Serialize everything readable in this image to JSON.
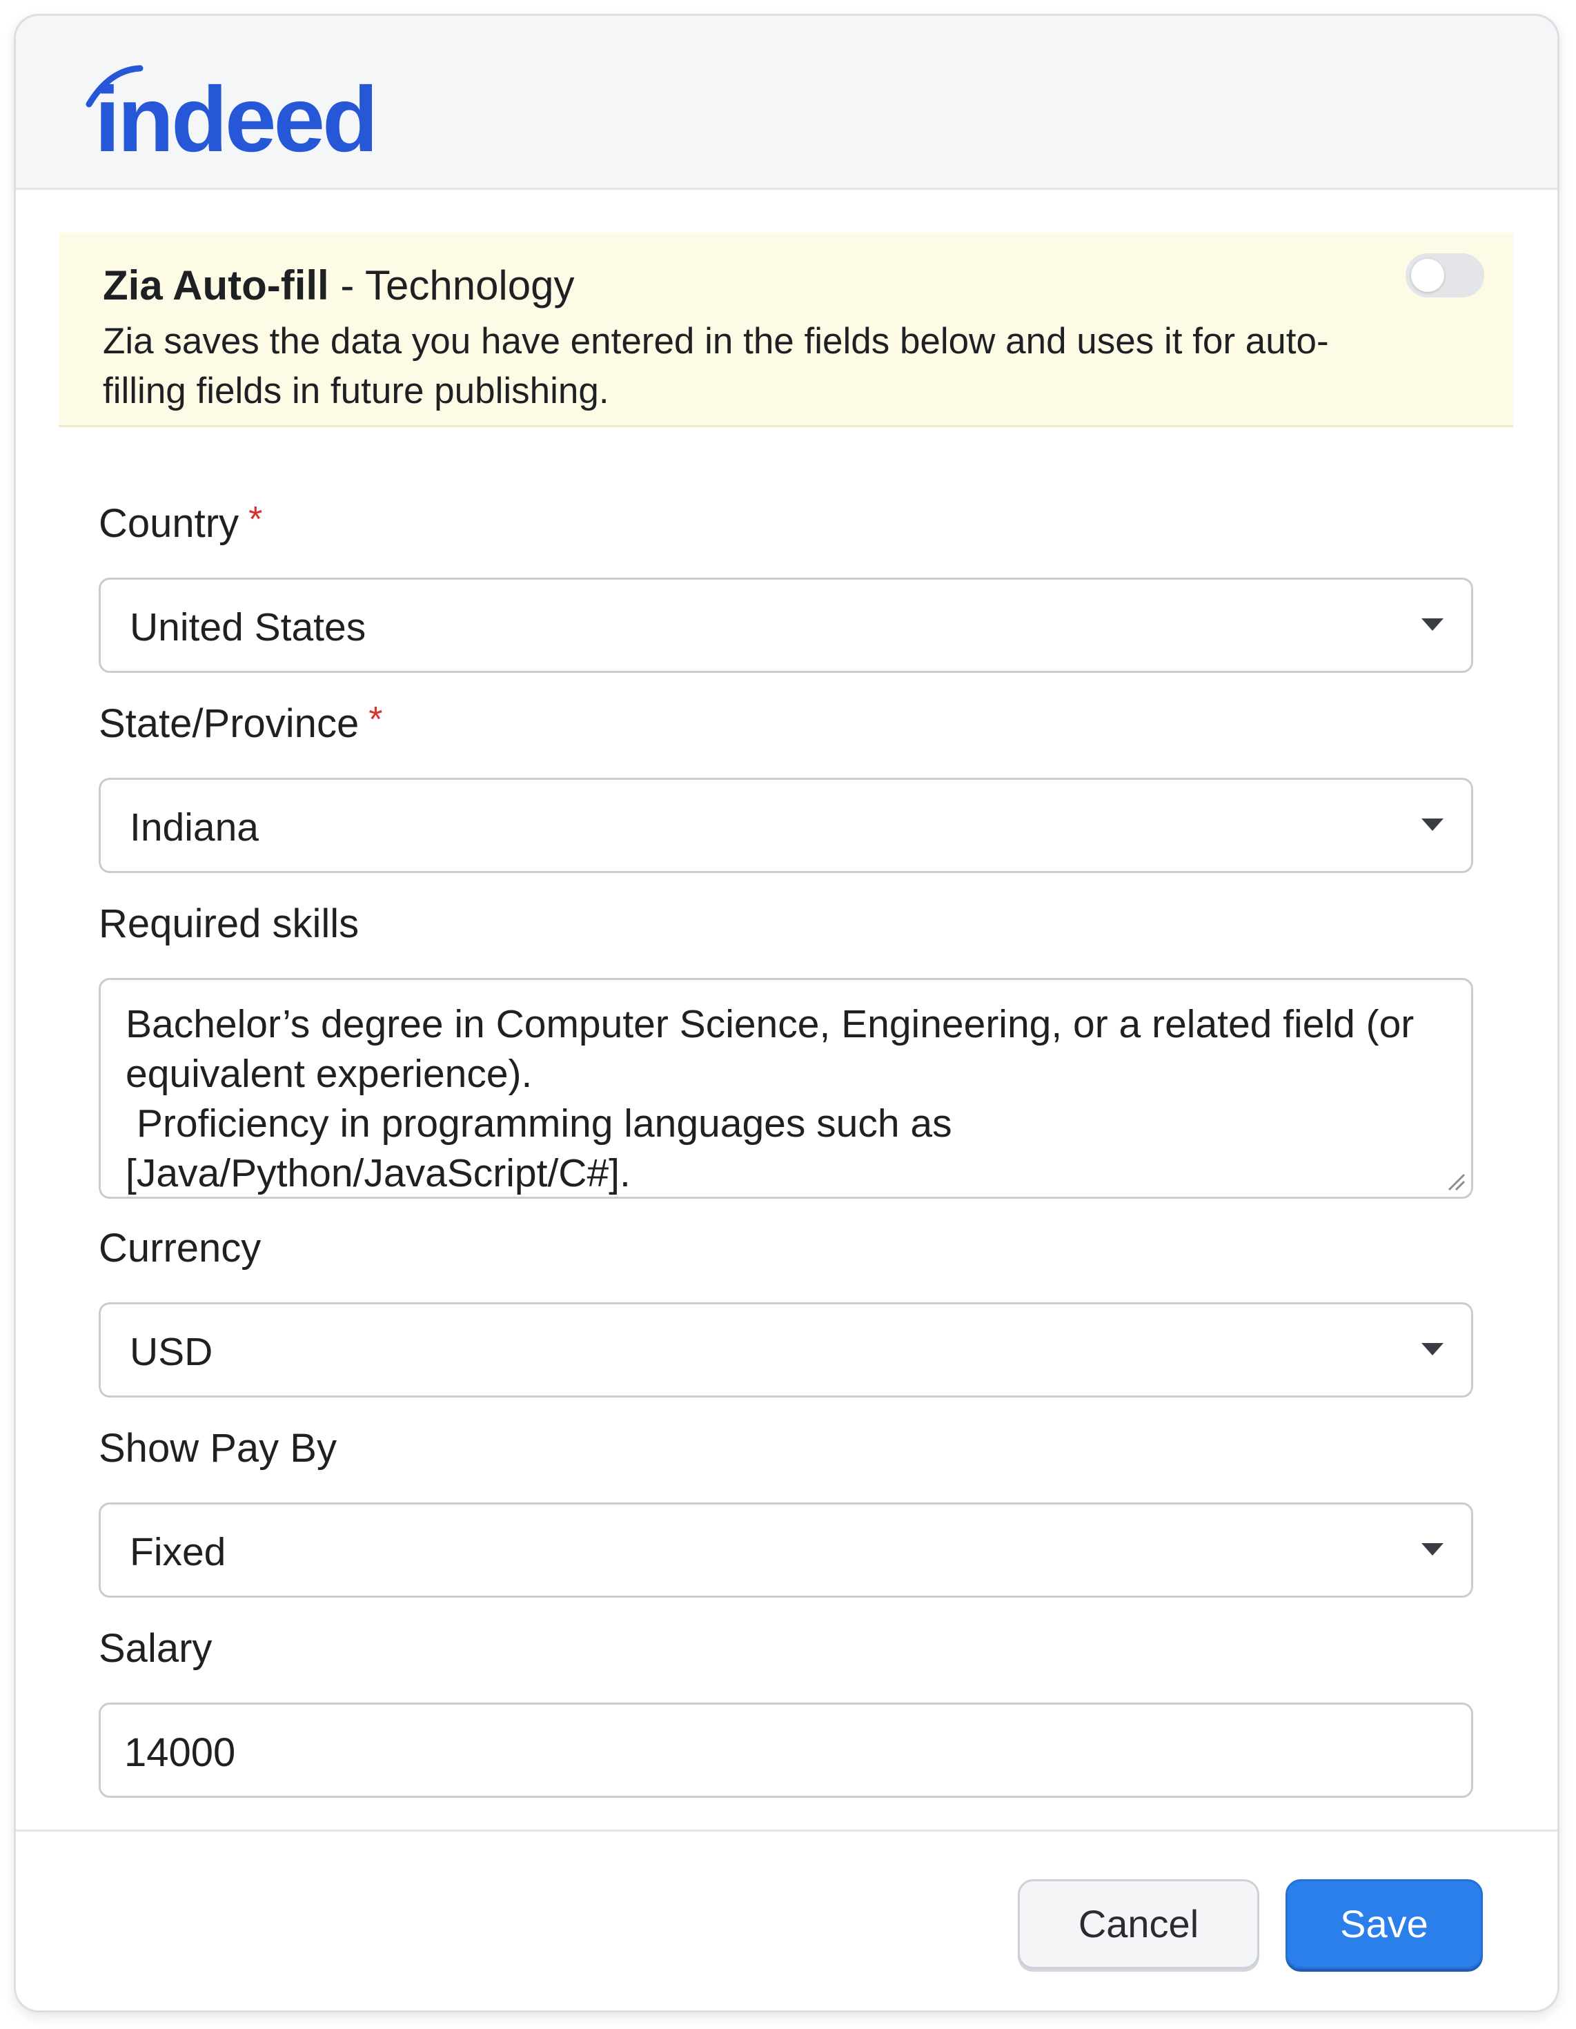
{
  "logo": {
    "text": "indeed",
    "color": "#2557d6"
  },
  "zia": {
    "title_bold": "Zia Auto-fill",
    "title_rest": " - Technology",
    "description": "Zia saves the data you have entered in the fields below and uses it for auto-filling fields in future publishing.",
    "toggle_state": "off"
  },
  "fields": {
    "country": {
      "label": "Country",
      "required_marker": "*",
      "value": "United States"
    },
    "state": {
      "label": "State/Province",
      "required_marker": "*",
      "value": "Indiana"
    },
    "skills": {
      "label": "Required skills",
      "value": "Bachelor’s degree in Computer Science, Engineering, or a related field (or equivalent experience).\n Proficiency in programming languages such as [Java/Python/JavaScript/C#]."
    },
    "currency": {
      "label": "Currency",
      "value": "USD"
    },
    "pay_by": {
      "label": "Show Pay By",
      "value": "Fixed"
    },
    "salary": {
      "label": "Salary",
      "value": "14000"
    }
  },
  "buttons": {
    "cancel": "Cancel",
    "save": "Save"
  },
  "colors": {
    "accent": "#2b7fea",
    "required": "#d9342b",
    "banner": "#fdfbe5"
  },
  "icons": {
    "dropdown": "chevron-down-icon",
    "resize": "resize-handle-icon"
  }
}
